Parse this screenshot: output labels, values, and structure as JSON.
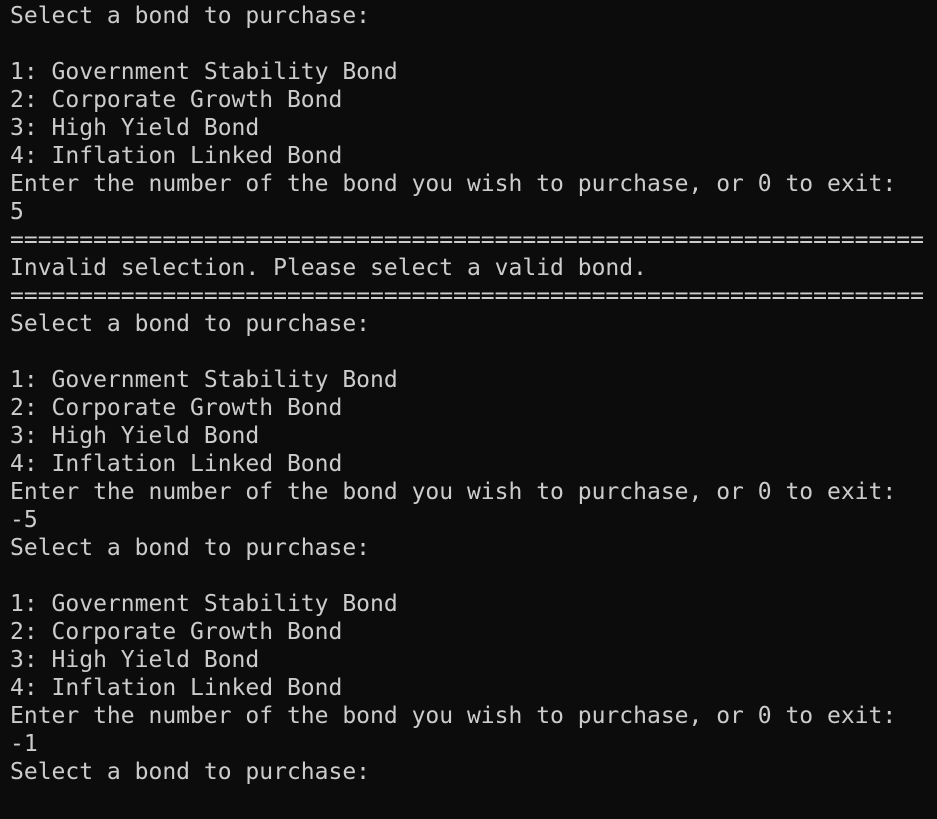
{
  "terminal": {
    "colors": {
      "background": "#0c0c0c",
      "foreground": "#cccccc"
    },
    "lines": [
      "Select a bond to purchase:",
      "",
      "1: Government Stability Bond",
      "2: Corporate Growth Bond",
      "3: High Yield Bond",
      "4: Inflation Linked Bond",
      "Enter the number of the bond you wish to purchase, or 0 to exit:",
      "5",
      "==================================================================",
      "Invalid selection. Please select a valid bond.",
      "==================================================================",
      "Select a bond to purchase:",
      "",
      "1: Government Stability Bond",
      "2: Corporate Growth Bond",
      "3: High Yield Bond",
      "4: Inflation Linked Bond",
      "Enter the number of the bond you wish to purchase, or 0 to exit:",
      "-5",
      "Select a bond to purchase:",
      "",
      "1: Government Stability Bond",
      "2: Corporate Growth Bond",
      "3: High Yield Bond",
      "4: Inflation Linked Bond",
      "Enter the number of the bond you wish to purchase, or 0 to exit:",
      "-1",
      "Select a bond to purchase:"
    ]
  }
}
